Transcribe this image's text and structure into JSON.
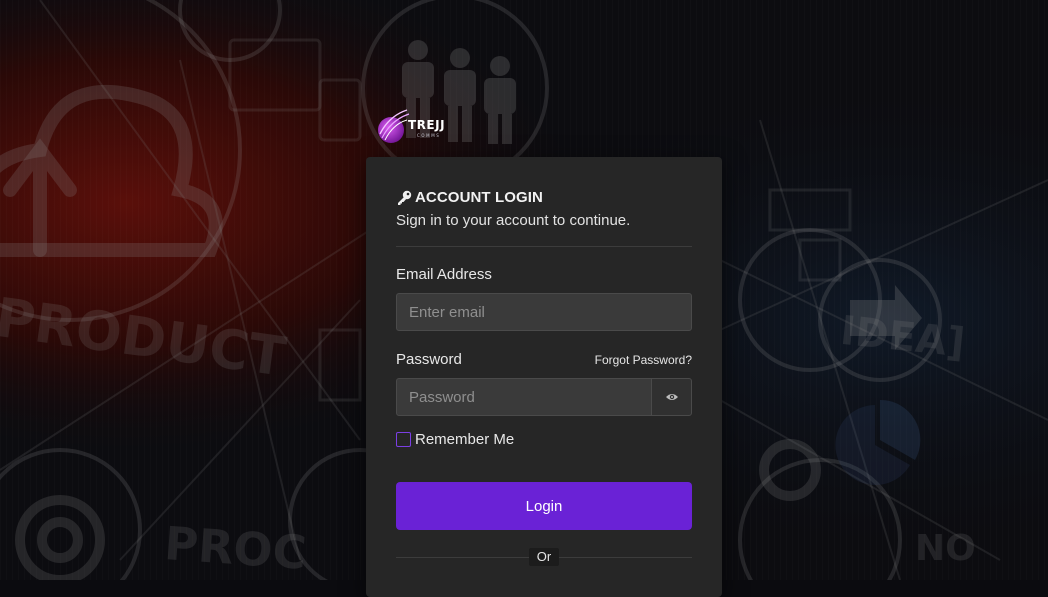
{
  "brand": {
    "name": "TREJJ",
    "tagline": "COMMS",
    "accent": "#8a2be2"
  },
  "login": {
    "title": "ACCOUNT LOGIN",
    "subtitle": "Sign in to your account to continue.",
    "email": {
      "label": "Email Address",
      "placeholder": "Enter email",
      "value": ""
    },
    "password": {
      "label": "Password",
      "placeholder": "Password",
      "value": ""
    },
    "forgot_label": "Forgot Password?",
    "remember_label": "Remember Me",
    "remember_checked": false,
    "login_button": "Login",
    "or_label": "Or"
  },
  "background_words": [
    "PRODUCT",
    "IDEA",
    "PRO"
  ],
  "colors": {
    "card_bg": "#262626",
    "primary_button": "#6a22d6",
    "checkbox_border": "#7b3fe4",
    "input_bg": "#3a3a3a"
  },
  "icons": {
    "title_icon": "key-icon",
    "password_toggle_icon": "eye-icon",
    "logo_icon": "swoosh-logo-icon"
  }
}
